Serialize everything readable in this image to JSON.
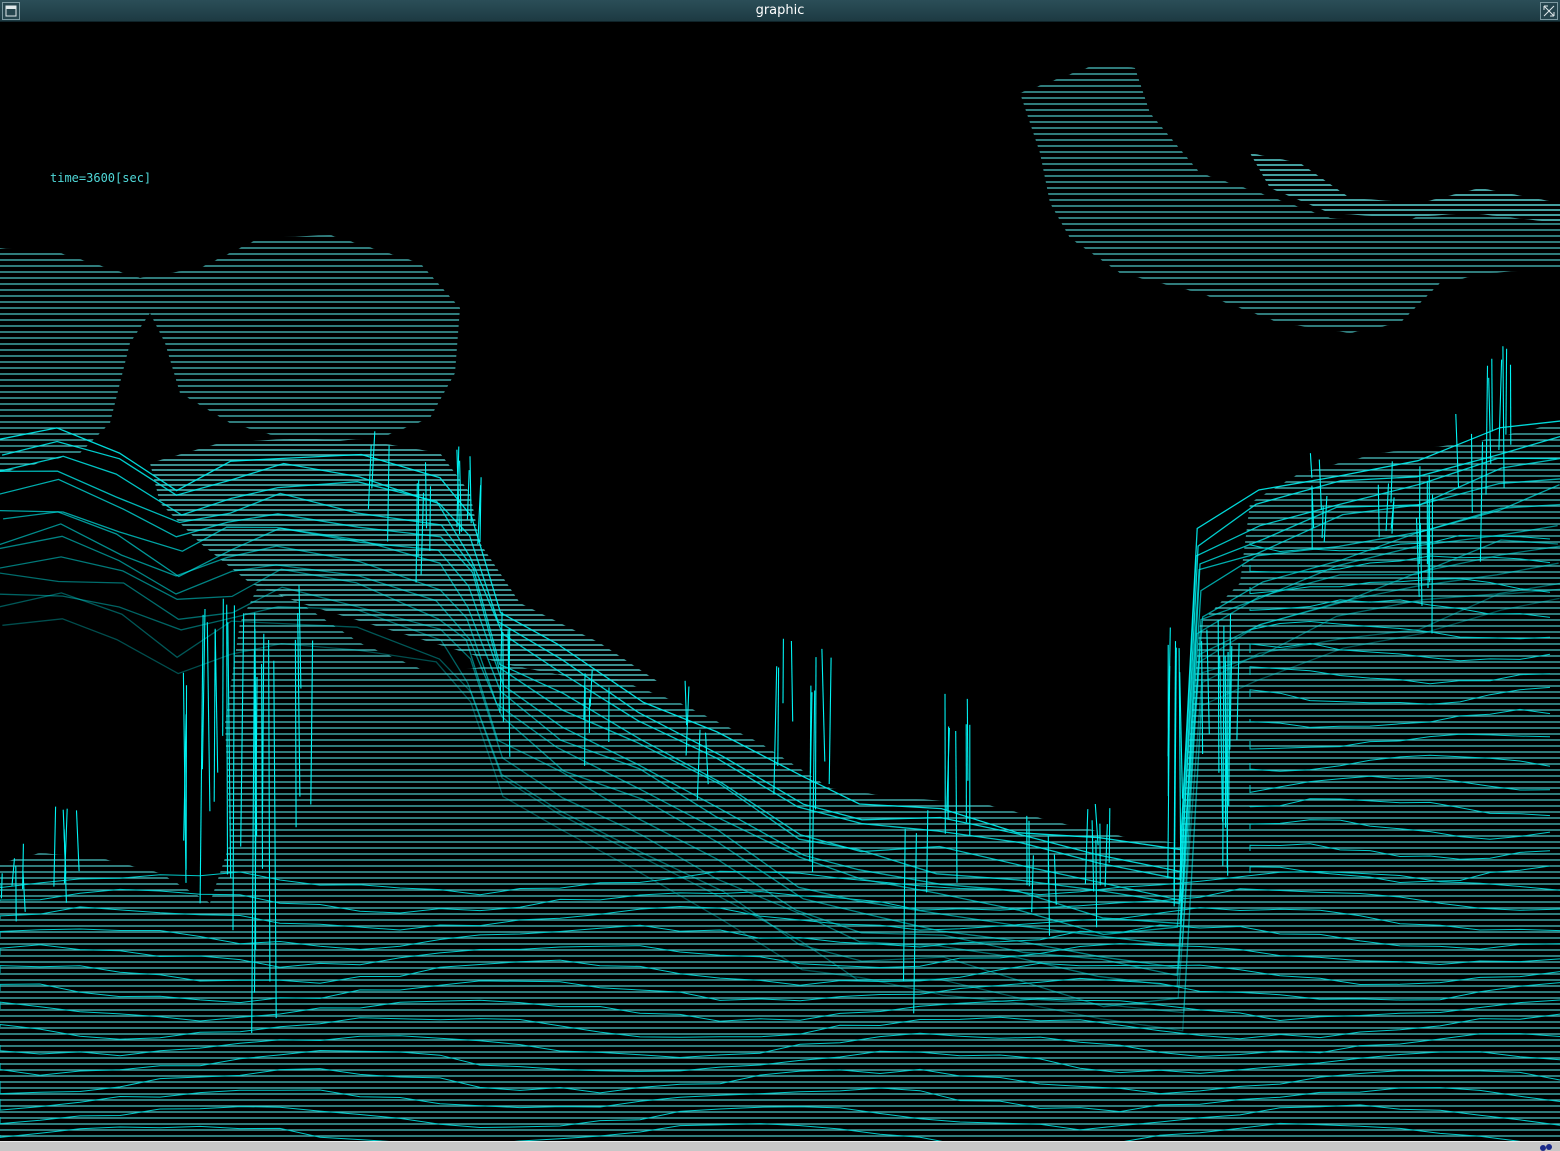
{
  "window": {
    "title": "graphic"
  },
  "titlebar": {
    "menu_icon": "window-menu-icon",
    "maximize_icon": "maximize-icon"
  },
  "canvas": {
    "time_label": "time=3600[sec]",
    "background_color": "#000000",
    "line_color": "#00e5e5",
    "surface_fill_color": "#5fa8a8"
  },
  "statusbar": {
    "tray_icon": "tray-network-icon"
  }
}
